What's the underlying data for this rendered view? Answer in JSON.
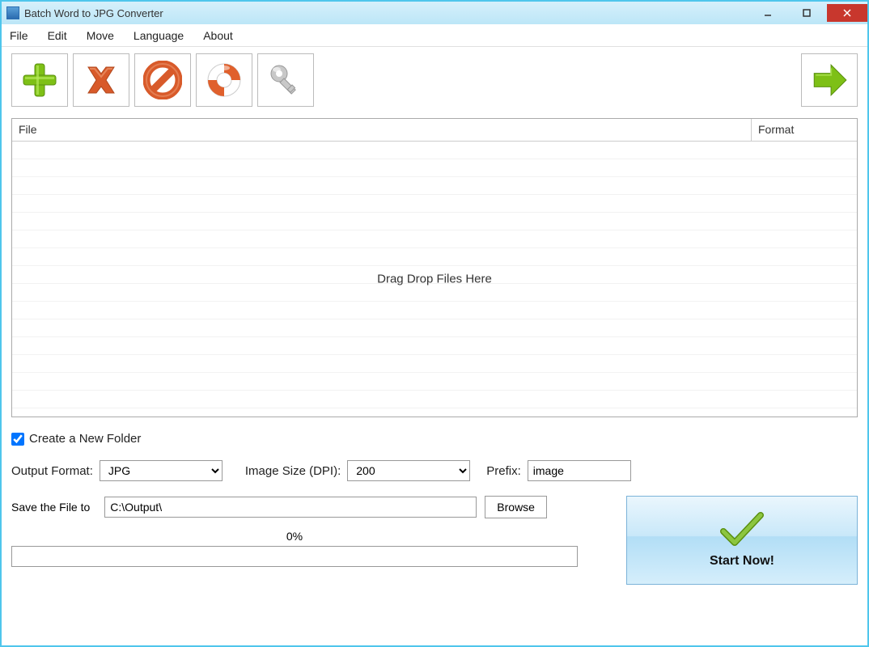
{
  "window": {
    "title": "Batch Word to JPG Converter"
  },
  "menu": {
    "items": [
      "File",
      "Edit",
      "Move",
      "Language",
      "About"
    ]
  },
  "toolbar": {
    "icons": [
      "add-icon",
      "remove-icon",
      "clear-icon",
      "help-icon",
      "key-icon",
      "start-icon"
    ]
  },
  "grid": {
    "col_file": "File",
    "col_format": "Format",
    "drag_hint": "Drag  Drop Files Here"
  },
  "options": {
    "create_folder_label": "Create a New Folder",
    "create_folder_checked": true,
    "output_format_label": "Output Format:",
    "output_format_value": "JPG",
    "image_size_label": "Image Size (DPI):",
    "image_size_value": "200",
    "prefix_label": "Prefix:",
    "prefix_value": "image",
    "save_label": "Save the File to",
    "save_path": "C:\\Output\\",
    "browse_label": "Browse",
    "progress_label": "0%",
    "start_label": "Start Now!"
  }
}
